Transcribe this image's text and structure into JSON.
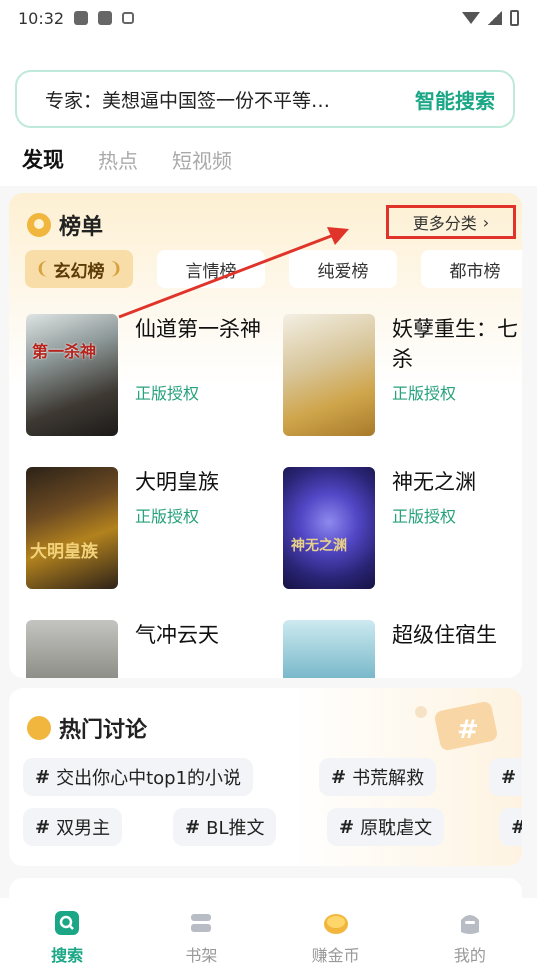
{
  "status_bar": {
    "time": "10:32"
  },
  "search": {
    "hint": "专家：美想逼中国签一份不平等…",
    "button": "智能搜索"
  },
  "tabs": [
    {
      "label": "发现",
      "active": true
    },
    {
      "label": "热点",
      "active": false
    },
    {
      "label": "短视频",
      "active": false
    }
  ],
  "ranking": {
    "title": "榜单",
    "more": "更多分类",
    "categories": [
      "玄幻榜",
      "言情榜",
      "纯爱榜",
      "都市榜"
    ],
    "books": [
      {
        "title": "仙道第一杀神",
        "badge": "正版授权",
        "cover_text": "第一杀神"
      },
      {
        "title": "妖孽重生：七杀",
        "badge": "正版授权",
        "cover_text": ""
      },
      {
        "title": "大明皇族",
        "badge": "正版授权",
        "cover_text": "大明皇族"
      },
      {
        "title": "神无之渊",
        "badge": "正版授权",
        "cover_text": "神无之渊"
      },
      {
        "title": "气冲云天",
        "badge": "",
        "cover_text": ""
      },
      {
        "title": "超级住宿生",
        "badge": "",
        "cover_text": ""
      }
    ]
  },
  "hot": {
    "title": "热门讨论",
    "tags_row1": [
      "交出你心中top1的小说",
      "书荒解救"
    ],
    "tags_row2": [
      "双男主",
      "BL推文",
      "原耽虐文"
    ]
  },
  "bottom_nav": [
    {
      "label": "搜索",
      "icon": "search-icon",
      "active": true
    },
    {
      "label": "书架",
      "icon": "bookshelf-icon",
      "active": false
    },
    {
      "label": "赚金币",
      "icon": "coin-icon",
      "active": false
    },
    {
      "label": "我的",
      "icon": "profile-icon",
      "active": false
    }
  ],
  "colors": {
    "accent": "#1ba786",
    "highlight": "#e0342a",
    "badge": "#26a17b"
  }
}
